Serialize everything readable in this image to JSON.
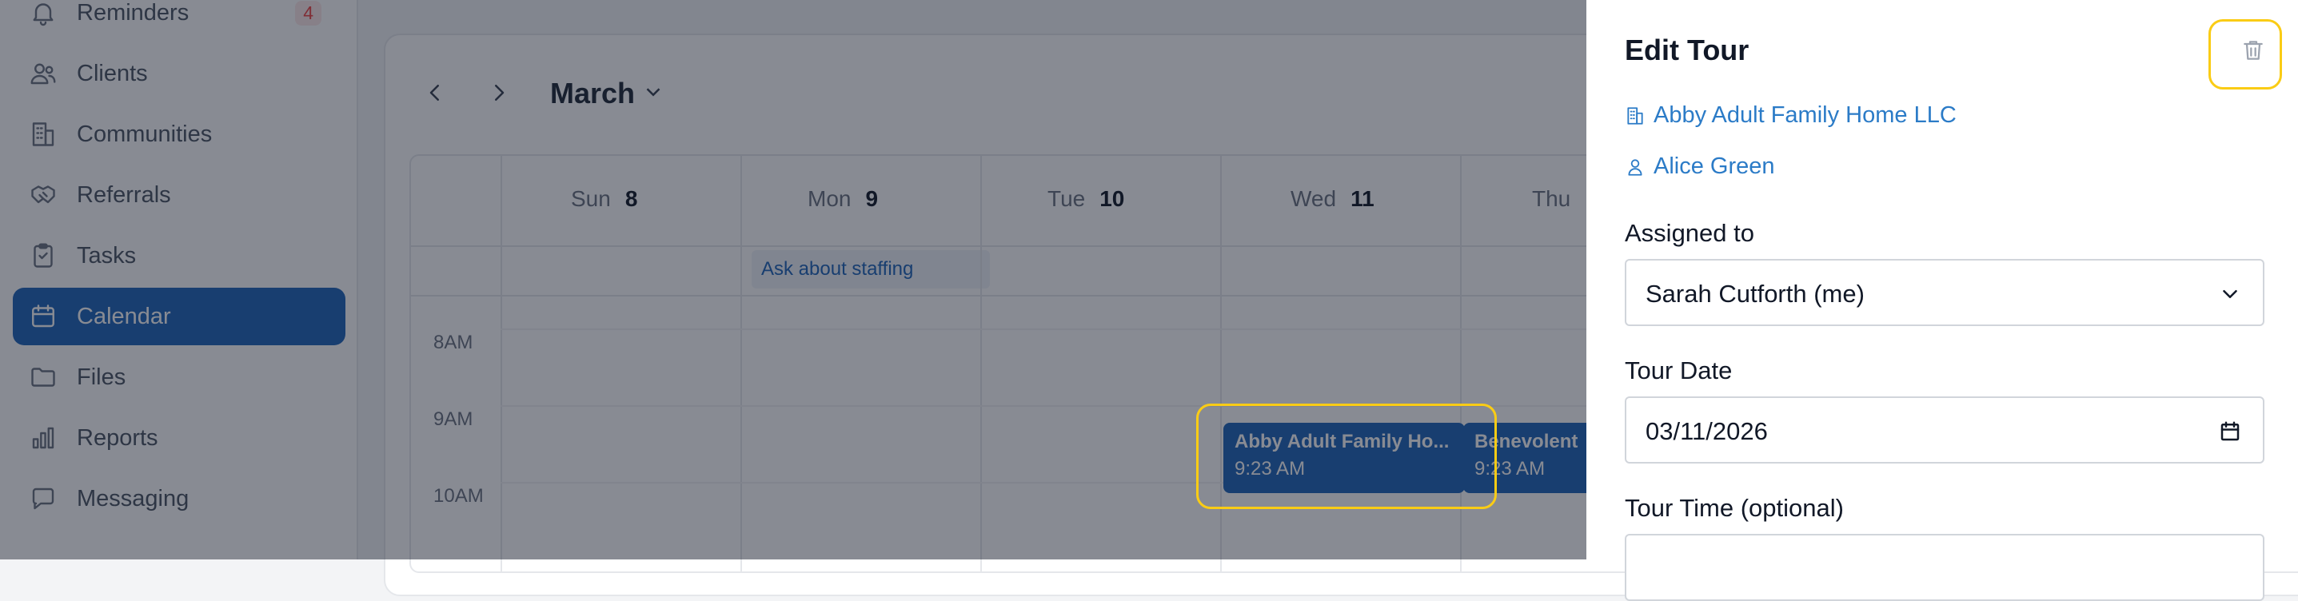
{
  "sidebar": {
    "items": [
      {
        "label": "Reminders",
        "icon": "bell-icon",
        "badge": "4"
      },
      {
        "label": "Clients",
        "icon": "users-icon"
      },
      {
        "label": "Communities",
        "icon": "building-icon"
      },
      {
        "label": "Referrals",
        "icon": "handshake-icon"
      },
      {
        "label": "Tasks",
        "icon": "clipboard-icon"
      },
      {
        "label": "Calendar",
        "icon": "calendar-icon",
        "active": true
      },
      {
        "label": "Files",
        "icon": "folder-icon"
      },
      {
        "label": "Reports",
        "icon": "bar-chart-icon"
      },
      {
        "label": "Messaging",
        "icon": "chat-icon"
      }
    ]
  },
  "calendar": {
    "month": "March",
    "days": [
      {
        "name": "Sun",
        "num": "8"
      },
      {
        "name": "Mon",
        "num": "9"
      },
      {
        "name": "Tue",
        "num": "10"
      },
      {
        "name": "Wed",
        "num": "11"
      },
      {
        "name": "Thu",
        "num": ""
      }
    ],
    "allday_event": "Ask about staffing",
    "times": [
      "8AM",
      "9AM",
      "10AM"
    ],
    "events": [
      {
        "title": "Abby Adult Family Ho...",
        "time": "9:23 AM"
      },
      {
        "title": "Benevolent",
        "time": "9:23 AM"
      }
    ]
  },
  "drawer": {
    "title": "Edit Tour",
    "community_link": "Abby Adult Family Home LLC",
    "client_link": "Alice Green",
    "assigned_label": "Assigned to",
    "assigned_value": "Sarah Cutforth (me)",
    "date_label": "Tour Date",
    "date_value": "03/11/2026",
    "time_label": "Tour Time (optional)"
  },
  "colors": {
    "accent": "#1e64b8",
    "link": "#2b7bc7",
    "highlight": "#facc15",
    "badge": "#ef4444"
  }
}
